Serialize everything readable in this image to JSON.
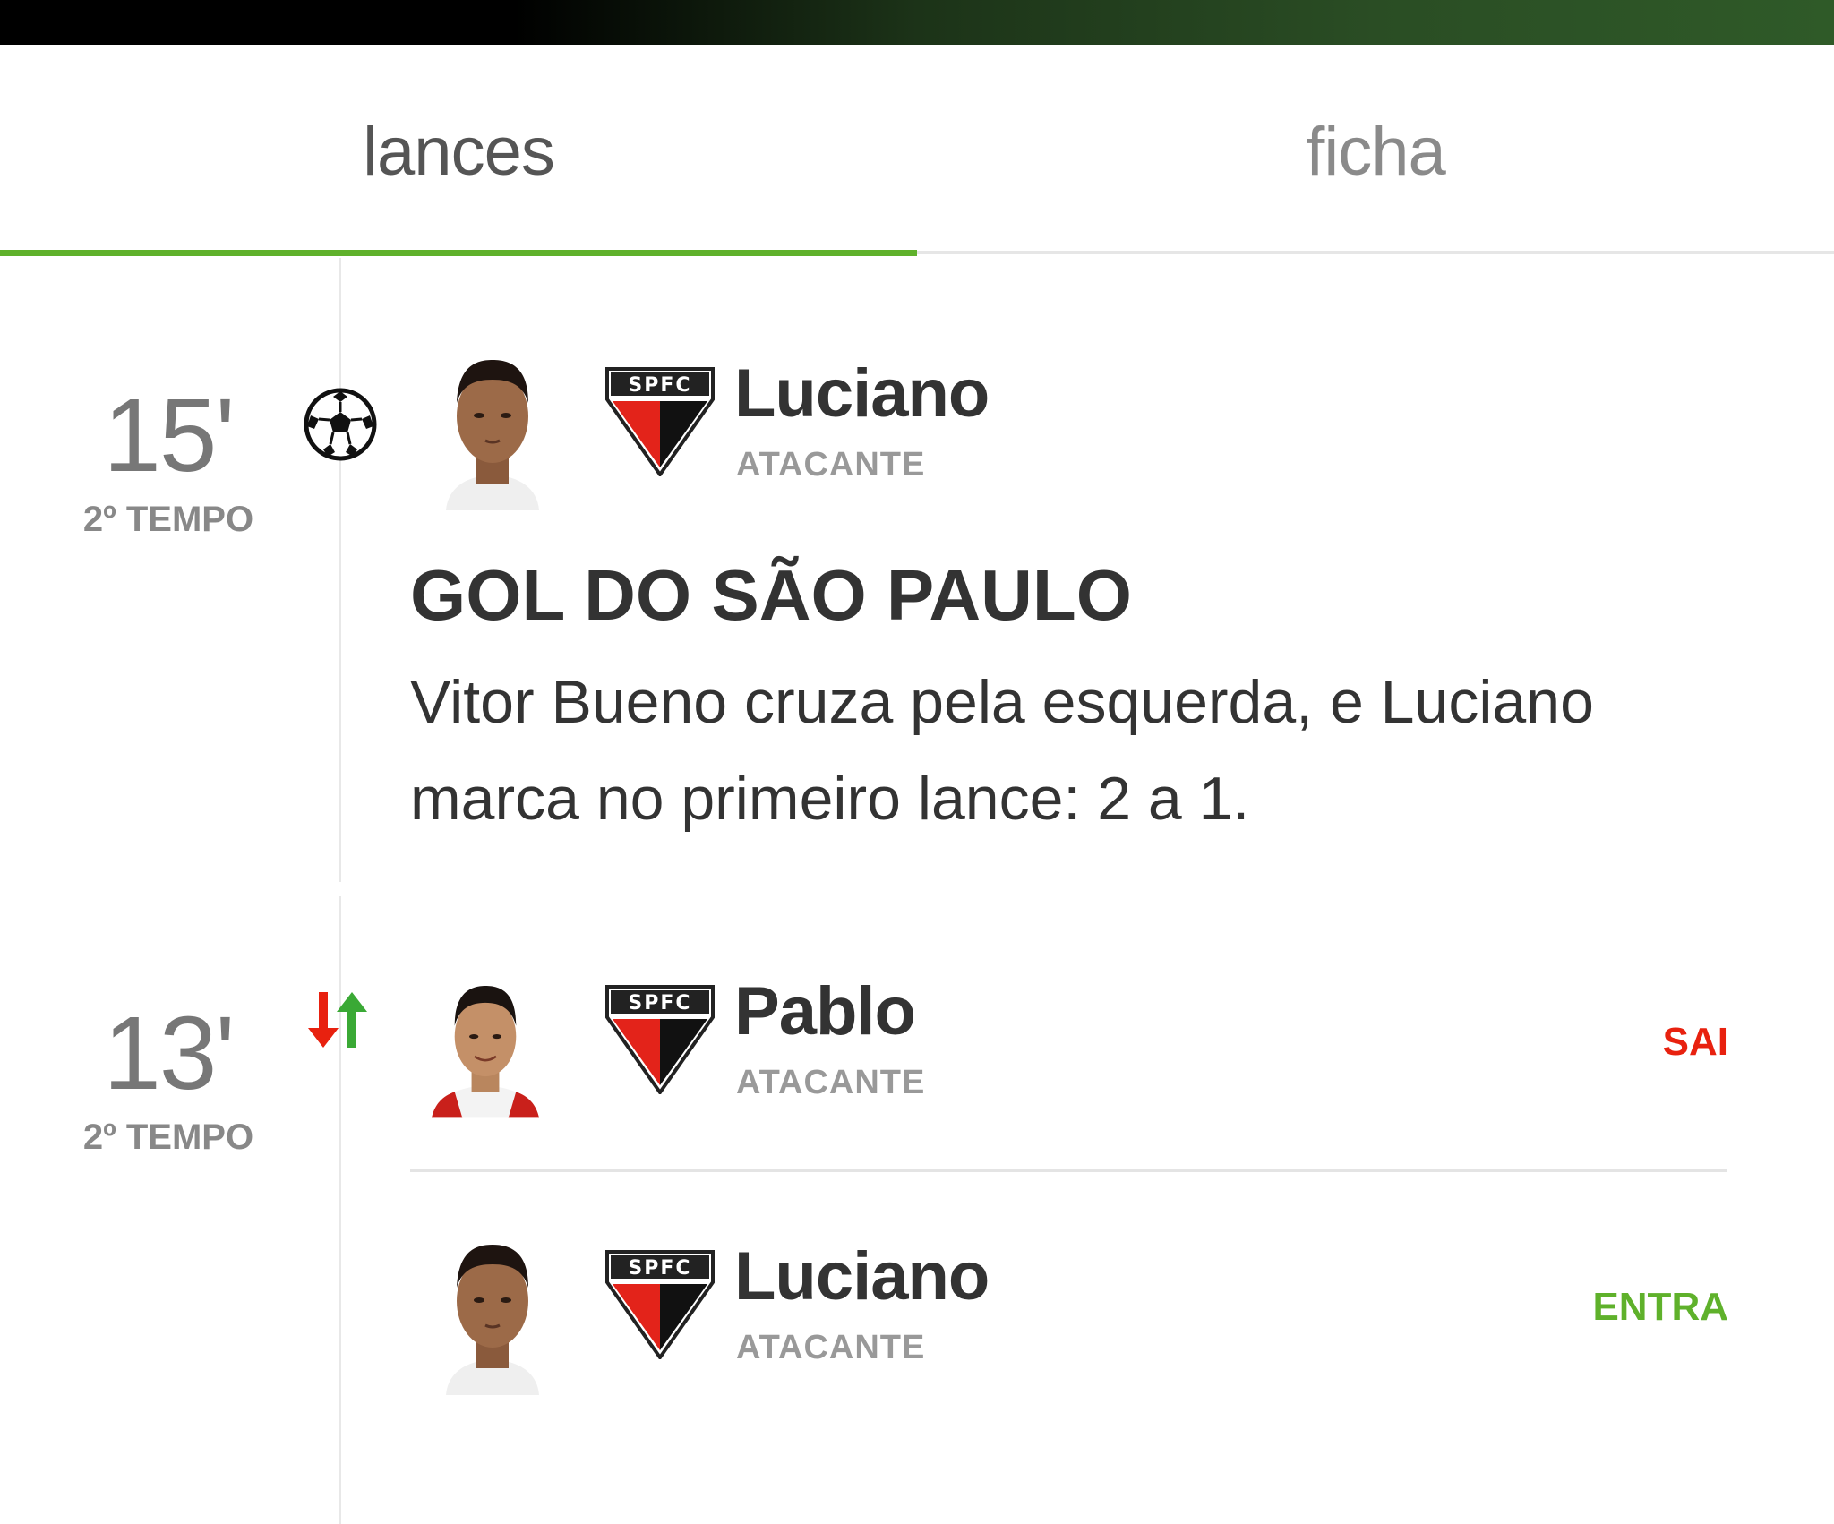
{
  "tabs": [
    {
      "label": "lances",
      "active": true
    },
    {
      "label": "ficha",
      "active": false
    }
  ],
  "colors": {
    "accent_green": "#5fb12b",
    "out_red": "#e8210f",
    "in_green": "#5fb12b"
  },
  "events": [
    {
      "minute": "15'",
      "period": "2º TEMPO",
      "icon": "soccer-ball-icon",
      "player": {
        "name": "Luciano",
        "position": "ATACANTE",
        "club_crest": "SPFC"
      },
      "headline": "GOL DO SÃO PAULO",
      "description": "Vitor Bueno cruza pela esquerda, e Luciano marca no primeiro lance: 2 a 1."
    },
    {
      "minute": "13'",
      "period": "2º TEMPO",
      "icon": "substitution-arrows-icon",
      "out": {
        "name": "Pablo",
        "position": "ATACANTE",
        "club_crest": "SPFC",
        "label": "SAI"
      },
      "in": {
        "name": "Luciano",
        "position": "ATACANTE",
        "club_crest": "SPFC",
        "label": "ENTRA"
      }
    }
  ]
}
